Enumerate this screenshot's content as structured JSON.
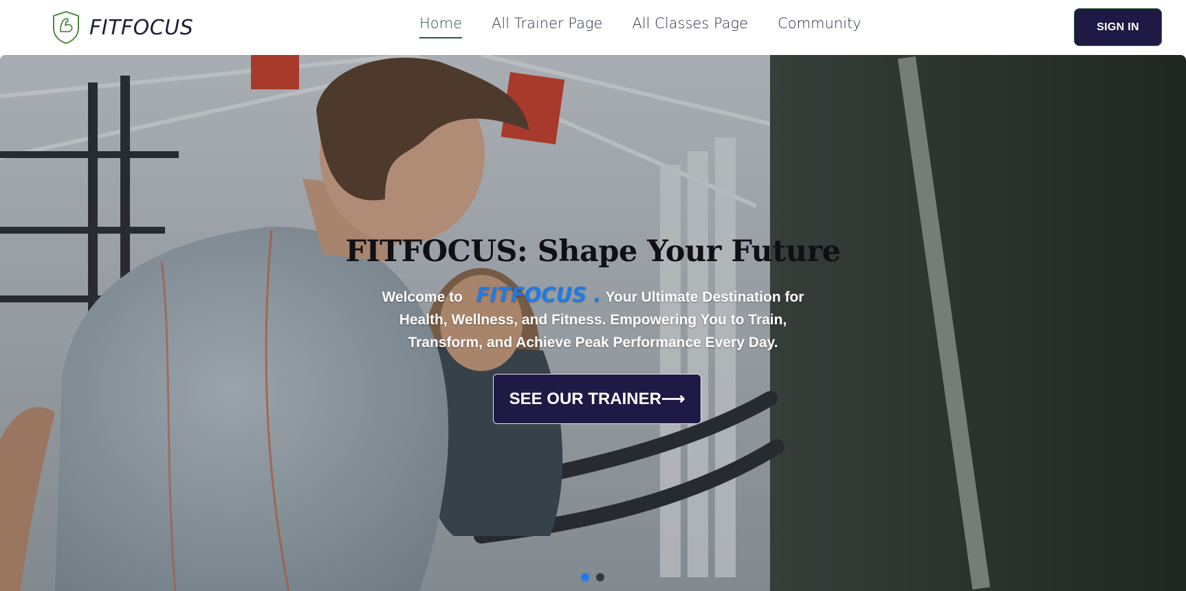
{
  "navbar": {
    "brand_name": "FITFOCUS",
    "links": [
      {
        "label": "Home",
        "active": true
      },
      {
        "label": "All Trainer Page",
        "active": false
      },
      {
        "label": "All Classes Page",
        "active": false
      },
      {
        "label": "Community",
        "active": false
      }
    ],
    "sign_in_label": "SIGN IN"
  },
  "hero": {
    "title": "FITFOCUS: Shape Your Future",
    "welcome_prefix": "Welcome to",
    "brand_inline": "FITFOCUS .",
    "description": "Your Ultimate Destination for Health, Wellness, and Fitness. Empowering You to Train, Transform, and Achieve Peak Performance Every Day.",
    "cta_label": "SEE OUR TRAINER⟶",
    "slides": [
      {
        "active": true
      },
      {
        "active": false
      }
    ]
  },
  "colors": {
    "primary_dark": "#1e1a45",
    "accent_blue": "#1f7ae8",
    "active_nav": "#1f5b3a"
  },
  "icons": {
    "logo": "flexed-arm-shield-icon"
  }
}
